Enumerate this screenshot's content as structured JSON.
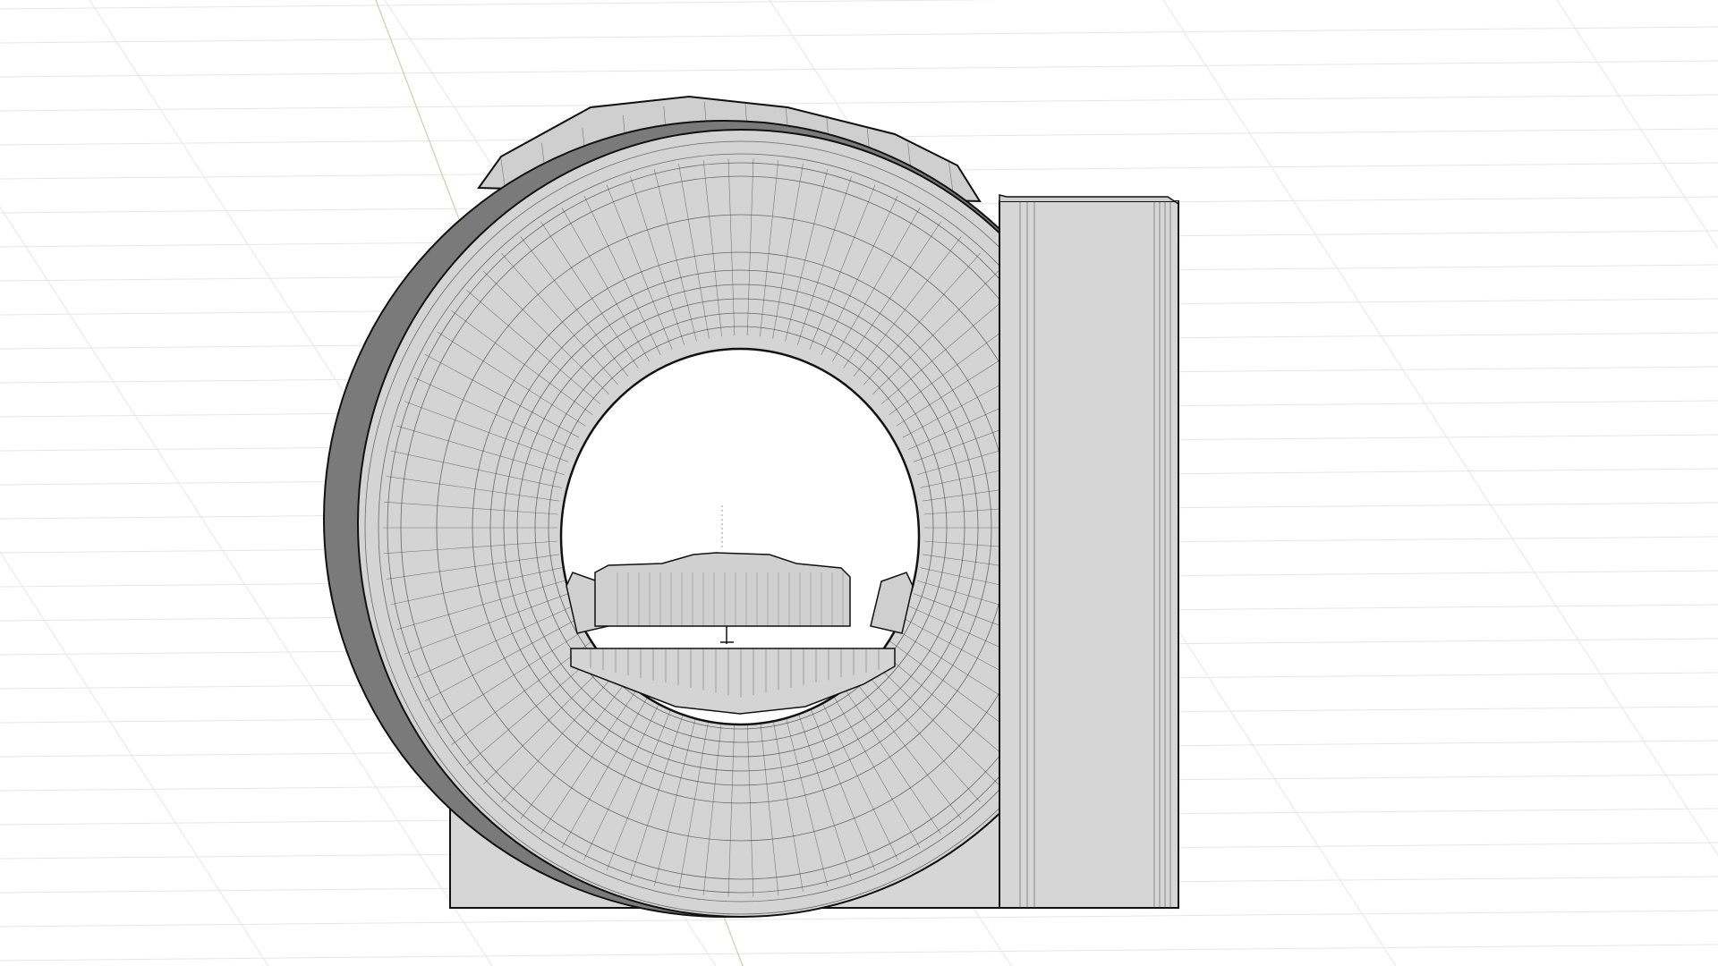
{
  "viewport": {
    "background": "#ffffff",
    "grid_color": "#e6e6e6",
    "axis_color": "#c9d0a8",
    "model_fill": "#d3d3d3",
    "model_shade": "#a9a9a9",
    "wire_color": "#3a3a3a",
    "outline_color": "#111111"
  },
  "model": {
    "type": "CT scanner gantry",
    "parts": [
      "gantry-ring",
      "gantry-base",
      "side-column",
      "patient-table",
      "bore-opening"
    ],
    "wireframe": true
  }
}
